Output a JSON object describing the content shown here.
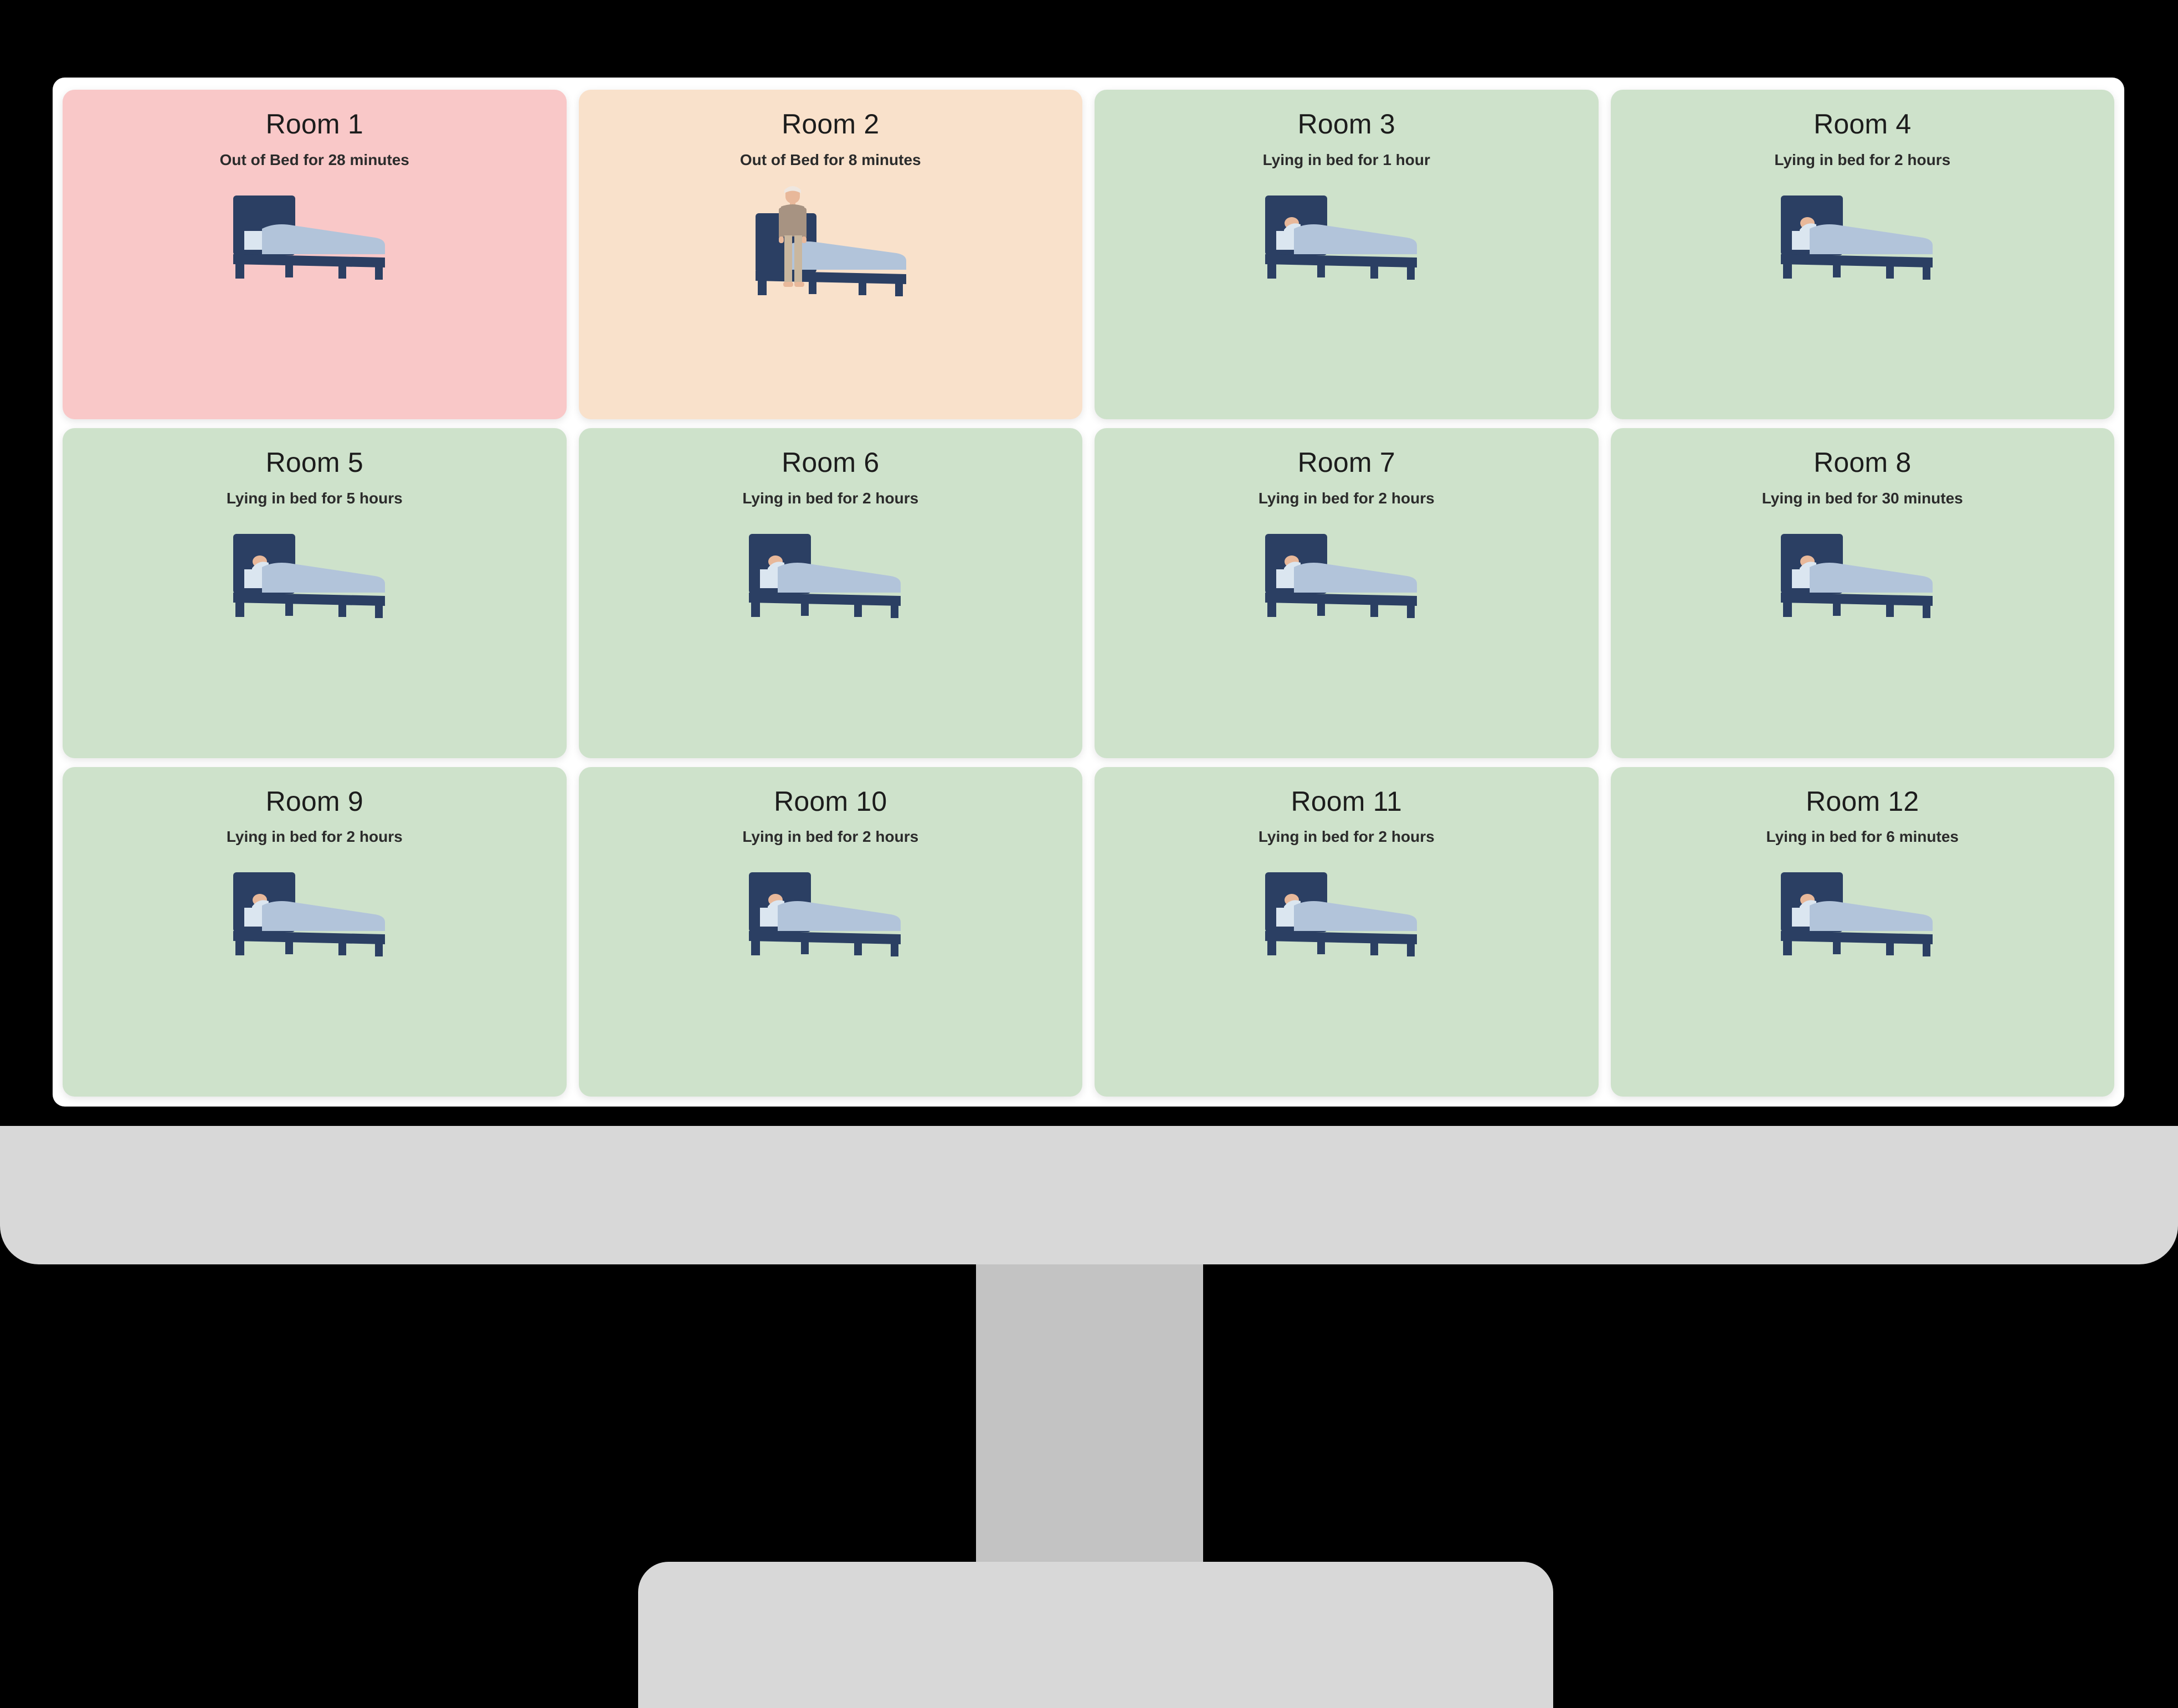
{
  "screen": {
    "rooms": [
      {
        "name": "Room 1",
        "status": "Out of Bed for 28 minutes",
        "state": "alert",
        "icon": "empty-bed-icon"
      },
      {
        "name": "Room 2",
        "status": "Out of Bed for 8 minutes",
        "state": "warning",
        "icon": "person-standing-beside-bed-icon"
      },
      {
        "name": "Room 3",
        "status": "Lying in bed for 1 hour",
        "state": "ok",
        "icon": "occupied-bed-icon"
      },
      {
        "name": "Room 4",
        "status": "Lying in bed for 2 hours",
        "state": "ok",
        "icon": "occupied-bed-icon"
      },
      {
        "name": "Room 5",
        "status": "Lying in bed for 5 hours",
        "state": "ok",
        "icon": "occupied-bed-icon"
      },
      {
        "name": "Room 6",
        "status": "Lying in bed for 2 hours",
        "state": "ok",
        "icon": "occupied-bed-icon"
      },
      {
        "name": "Room 7",
        "status": "Lying in bed for 2 hours",
        "state": "ok",
        "icon": "occupied-bed-icon"
      },
      {
        "name": "Room 8",
        "status": "Lying in bed for 30 minutes",
        "state": "ok",
        "icon": "occupied-bed-icon"
      },
      {
        "name": "Room 9",
        "status": "Lying in bed for 2 hours",
        "state": "ok",
        "icon": "occupied-bed-icon"
      },
      {
        "name": "Room 10",
        "status": "Lying in bed for 2 hours",
        "state": "ok",
        "icon": "occupied-bed-icon"
      },
      {
        "name": "Room 11",
        "status": "Lying in bed for 2 hours",
        "state": "ok",
        "icon": "occupied-bed-icon"
      },
      {
        "name": "Room 12",
        "status": "Lying in bed for 6 minutes",
        "state": "ok",
        "icon": "occupied-bed-icon"
      }
    ]
  },
  "colors": {
    "alert_background": "#f9c8c8",
    "warning_background": "#f9e1cb",
    "ok_background": "#cee2cb",
    "page_background": "#ffffff",
    "bezel": "#000000",
    "chin": "#d8d8d8",
    "stand_neck": "#c3c3c3",
    "stand_base": "#d8d8d8",
    "bed_frame": "#2b3f63",
    "bed_blanket": "#b2c4da",
    "bed_pillow": "#dbe6f0",
    "person_skin": "#e8b89a",
    "person_clothing": "#a79382",
    "title_text": "#1c1c1c",
    "status_text": "#2b2b2b"
  }
}
